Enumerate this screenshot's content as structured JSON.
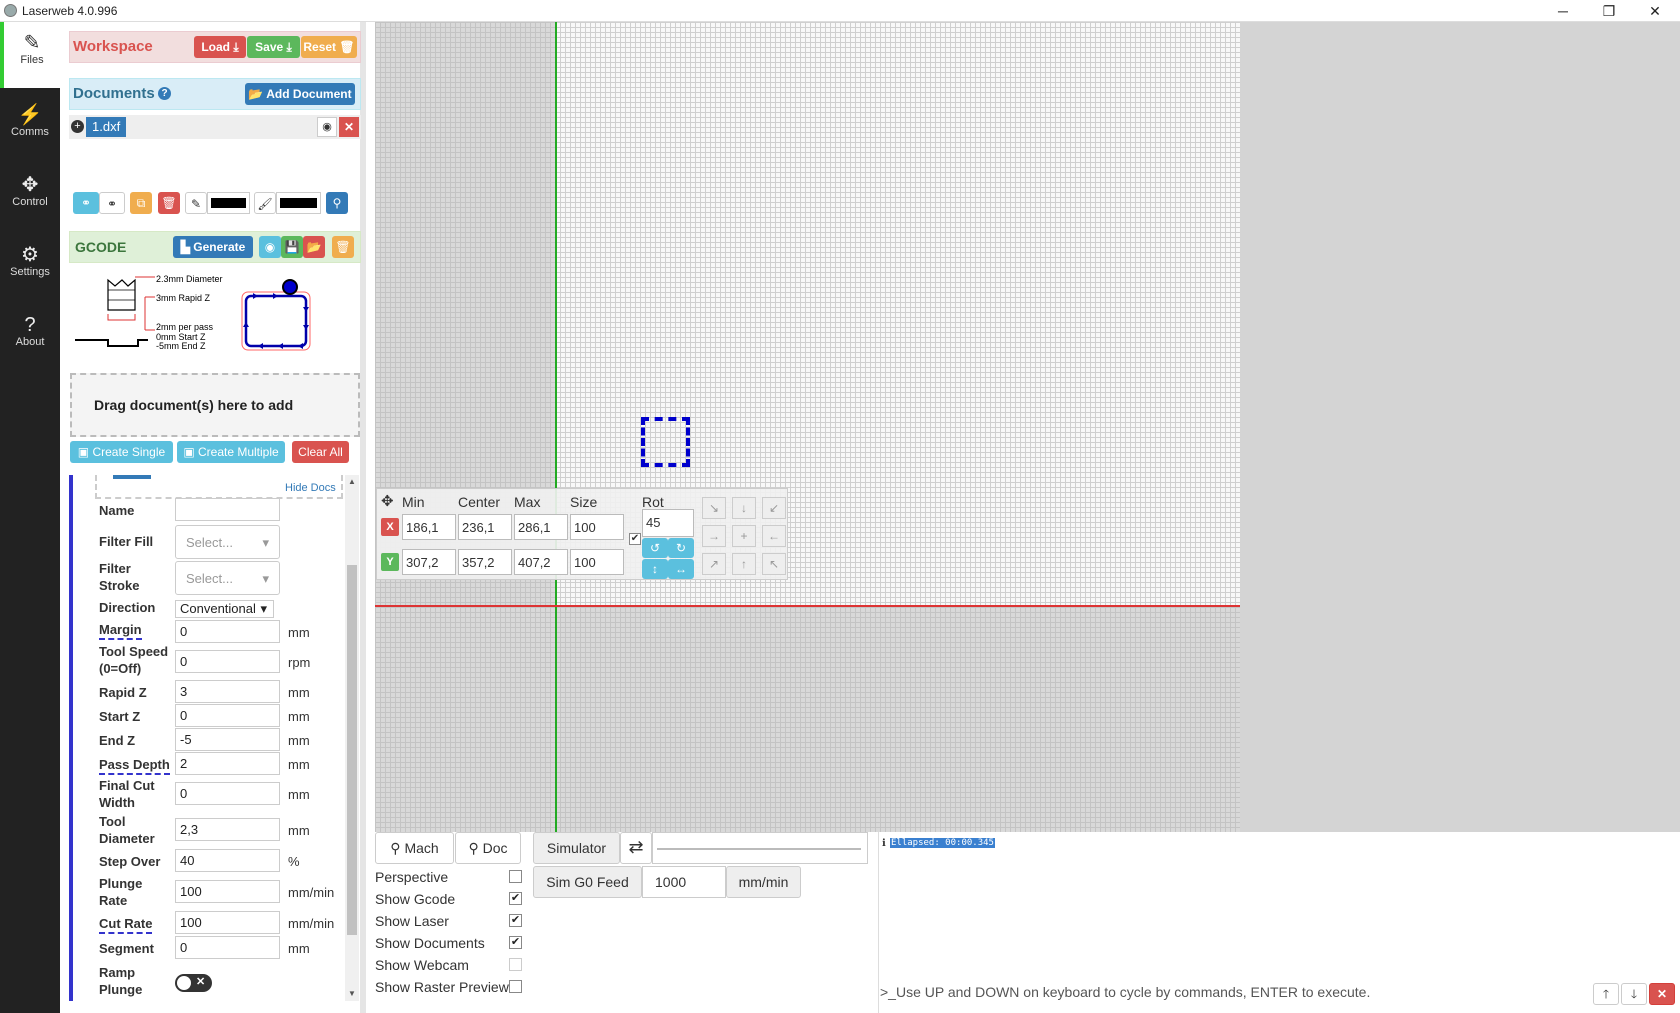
{
  "window": {
    "title": "Laserweb 4.0.996",
    "minimize": "─",
    "restore": "❐",
    "close": "✕"
  },
  "nav": [
    {
      "label": "Files",
      "icon": "✎"
    },
    {
      "label": "Comms",
      "icon": "⚡"
    },
    {
      "label": "Control",
      "icon": "✥"
    },
    {
      "label": "Settings",
      "icon": "⚙"
    },
    {
      "label": "About",
      "icon": "?"
    }
  ],
  "workspace": {
    "title": "Workspace",
    "load": "Load",
    "save": "Save",
    "reset": "Reset"
  },
  "documents": {
    "title": "Documents",
    "help": "?",
    "add": "Add Document",
    "file": "1.dxf"
  },
  "gcode": {
    "title": "GCODE",
    "generate": "Generate"
  },
  "diagram": {
    "diameter": "2.3mm Diameter",
    "rapid": "3mm Rapid Z",
    "perpass": "2mm per pass",
    "startz": "0mm Start Z",
    "endz": "-5mm End Z"
  },
  "dropzone": "Drag document(s) here to add",
  "ops": {
    "create_single": "Create Single",
    "create_multiple": "Create Multiple",
    "clear_all": "Clear All",
    "hide_docs": "Hide Docs"
  },
  "fields": {
    "name": {
      "label": "Name",
      "value": ""
    },
    "filter_fill": {
      "label": "Filter Fill",
      "value": "Select..."
    },
    "filter_stroke": {
      "label1": "Filter",
      "label2": "Stroke",
      "value": "Select..."
    },
    "direction": {
      "label": "Direction",
      "value": "Conventional"
    },
    "margin": {
      "label": "Margin",
      "value": "0",
      "unit": "mm"
    },
    "tool_speed": {
      "label1": "Tool Speed",
      "label2": "(0=Off)",
      "value": "0",
      "unit": "rpm"
    },
    "rapid_z": {
      "label": "Rapid Z",
      "value": "3",
      "unit": "mm"
    },
    "start_z": {
      "label": "Start Z",
      "value": "0",
      "unit": "mm"
    },
    "end_z": {
      "label": "End Z",
      "value": "-5",
      "unit": "mm"
    },
    "pass_depth": {
      "label": "Pass Depth",
      "value": "2",
      "unit": "mm"
    },
    "final_cut": {
      "label1": "Final Cut",
      "label2": "Width",
      "value": "0",
      "unit": "mm"
    },
    "tool_diameter": {
      "label1": "Tool",
      "label2": "Diameter",
      "value": "2,3",
      "unit": "mm"
    },
    "step_over": {
      "label": "Step Over",
      "value": "40",
      "unit": "%"
    },
    "plunge_rate": {
      "label1": "Plunge",
      "label2": "Rate",
      "value": "100",
      "unit": "mm/min"
    },
    "cut_rate": {
      "label": "Cut Rate",
      "value": "100",
      "unit": "mm/min"
    },
    "segment": {
      "label": "Segment",
      "value": "0",
      "unit": "mm"
    },
    "ramp": {
      "label1": "Ramp",
      "label2": "Plunge"
    }
  },
  "transform": {
    "headers": {
      "min": "Min",
      "center": "Center",
      "max": "Max",
      "size": "Size",
      "rot": "Rot"
    },
    "x": {
      "label": "X",
      "min": "186,1",
      "center": "236,1",
      "max": "286,1",
      "size": "100"
    },
    "y": {
      "label": "Y",
      "min": "307,2",
      "center": "357,2",
      "max": "407,2",
      "size": "100"
    },
    "rot": "45"
  },
  "toolbar": {
    "mach": "Mach",
    "doc": "Doc",
    "simulator": "Simulator",
    "sim_g0_feed": "Sim G0 Feed",
    "feed_value": "1000",
    "feed_unit": "mm/min"
  },
  "display_options": [
    {
      "label": "Perspective",
      "checked": false
    },
    {
      "label": "Show Gcode",
      "checked": true
    },
    {
      "label": "Show Laser",
      "checked": true
    },
    {
      "label": "Show Documents",
      "checked": true
    },
    {
      "label": "Show Webcam",
      "checked": false
    },
    {
      "label": "Show Raster Preview",
      "checked": false
    }
  ],
  "console": {
    "info_icon": "ℹ",
    "output": "Ellapsed: 00:00.345",
    "prompt": ">_",
    "placeholder": "Use UP and DOWN on keyboard to cycle by commands, ENTER to execute."
  },
  "colors": {
    "accent_green": "#33cc33",
    "workspace_red": "#d9534f",
    "documents_blue": "#337ab7",
    "gcode_green": "#5cb85c",
    "axis_x": "#dd3333",
    "axis_y": "#22aa22",
    "shape": "#0000cc"
  }
}
